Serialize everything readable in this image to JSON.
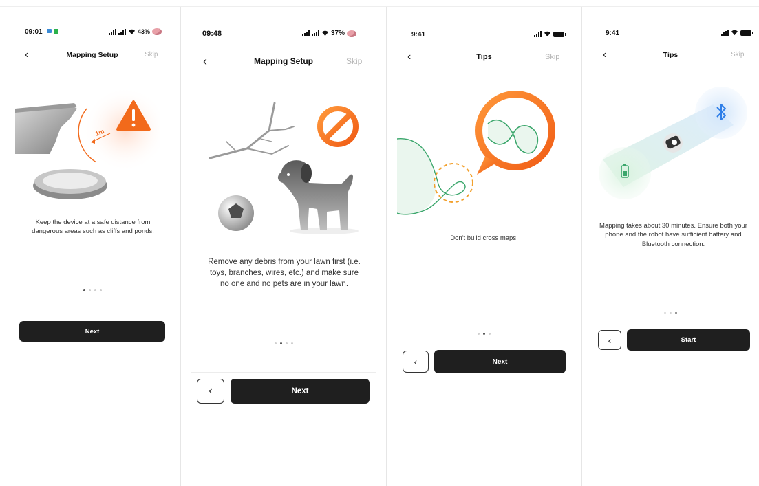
{
  "panels": [
    {
      "status": {
        "time": "09:01",
        "battery": "43%"
      },
      "nav": {
        "back": "‹",
        "title": "Mapping Setup",
        "skip": "Skip"
      },
      "illustration": "cliff-pond-warning",
      "description": "Keep the device at a safe distance from dangerous areas such as cliffs and ponds.",
      "distance_label": "1m",
      "pagination": {
        "total": 4,
        "active": 0
      },
      "actions": {
        "next": "Next"
      }
    },
    {
      "status": {
        "time": "09:48",
        "battery": "37%"
      },
      "nav": {
        "back": "‹",
        "title": "Mapping Setup",
        "skip": "Skip"
      },
      "illustration": "debris-pets",
      "description": "Remove any debris from your lawn first (i.e. toys, branches, wires, etc.) and make sure no one and no pets are in your lawn.",
      "pagination": {
        "total": 4,
        "active": 1
      },
      "actions": {
        "back": "‹",
        "next": "Next"
      }
    },
    {
      "status": {
        "time": "9:41"
      },
      "nav": {
        "back": "‹",
        "title": "Tips",
        "skip": "Skip"
      },
      "illustration": "cross-map-loop",
      "description": "Don't build cross maps.",
      "pagination": {
        "total": 3,
        "active": 1
      },
      "actions": {
        "back": "‹",
        "next": "Next"
      }
    },
    {
      "status": {
        "time": "9:41"
      },
      "nav": {
        "back": "‹",
        "title": "Tips",
        "skip": "Skip"
      },
      "illustration": "battery-bluetooth-robot",
      "description": "Mapping takes about 30 minutes. Ensure both your phone and the robot have sufficient battery and Bluetooth connection.",
      "pagination": {
        "total": 3,
        "active": 2
      },
      "actions": {
        "back": "‹",
        "start": "Start"
      }
    }
  ],
  "colors": {
    "primary_button": "#1f1f1f",
    "warning_orange": "#f26a1b",
    "map_green": "#3aa66b",
    "bluetooth_blue": "#2f7fe8",
    "skip_gray": "#b5b5b5"
  }
}
